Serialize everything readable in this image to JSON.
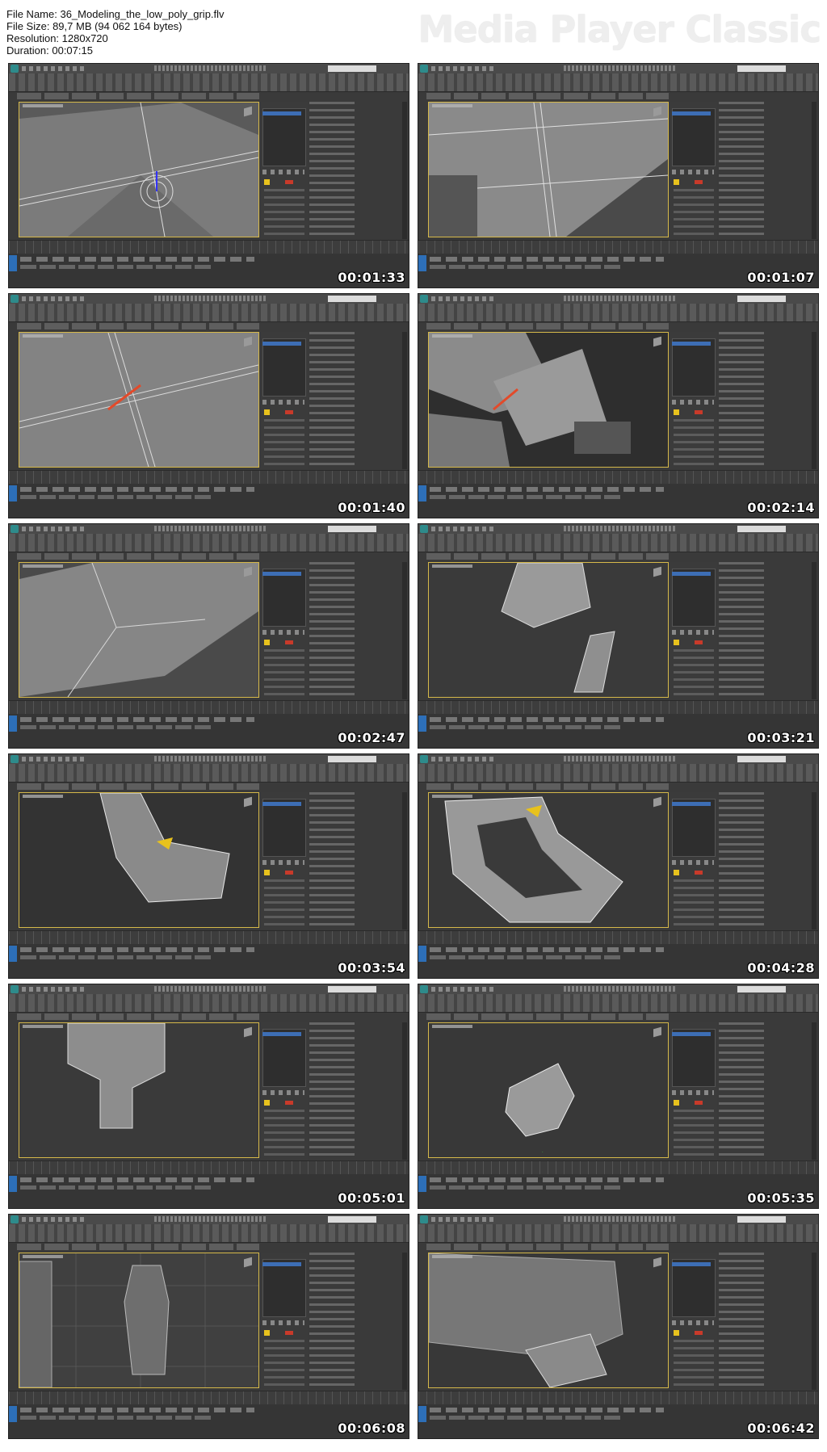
{
  "header": {
    "file_name": "File Name: 36_Modeling_the_low_poly_grip.flv",
    "file_size": "File Size: 89,7 MB (94 062 164 bytes)",
    "resolution": "Resolution: 1280x720",
    "duration": "Duration: 00:07:15"
  },
  "brand": "Media Player Classic",
  "colors": {
    "background": "#ffffff",
    "viewport_border": "#d6b94a",
    "selection_blue": "#3d6eb5",
    "gizmo_yellow": "#e8c21d",
    "axis_red": "#c83a2a"
  },
  "thumbnails": [
    {
      "timestamp": "00:01:33",
      "scene": "wire-plate"
    },
    {
      "timestamp": "00:01:07",
      "scene": "wire-arm"
    },
    {
      "timestamp": "00:01:40",
      "scene": "wire-plate-red"
    },
    {
      "timestamp": "00:02:14",
      "scene": "blocks"
    },
    {
      "timestamp": "00:02:47",
      "scene": "plane-flat"
    },
    {
      "timestamp": "00:03:21",
      "scene": "grip-start"
    },
    {
      "timestamp": "00:03:54",
      "scene": "grip-curve"
    },
    {
      "timestamp": "00:04:28",
      "scene": "grip-loop"
    },
    {
      "timestamp": "00:05:01",
      "scene": "grip-close"
    },
    {
      "timestamp": "00:05:35",
      "scene": "grip-small"
    },
    {
      "timestamp": "00:06:08",
      "scene": "front-view"
    },
    {
      "timestamp": "00:06:42",
      "scene": "full-wire"
    }
  ]
}
